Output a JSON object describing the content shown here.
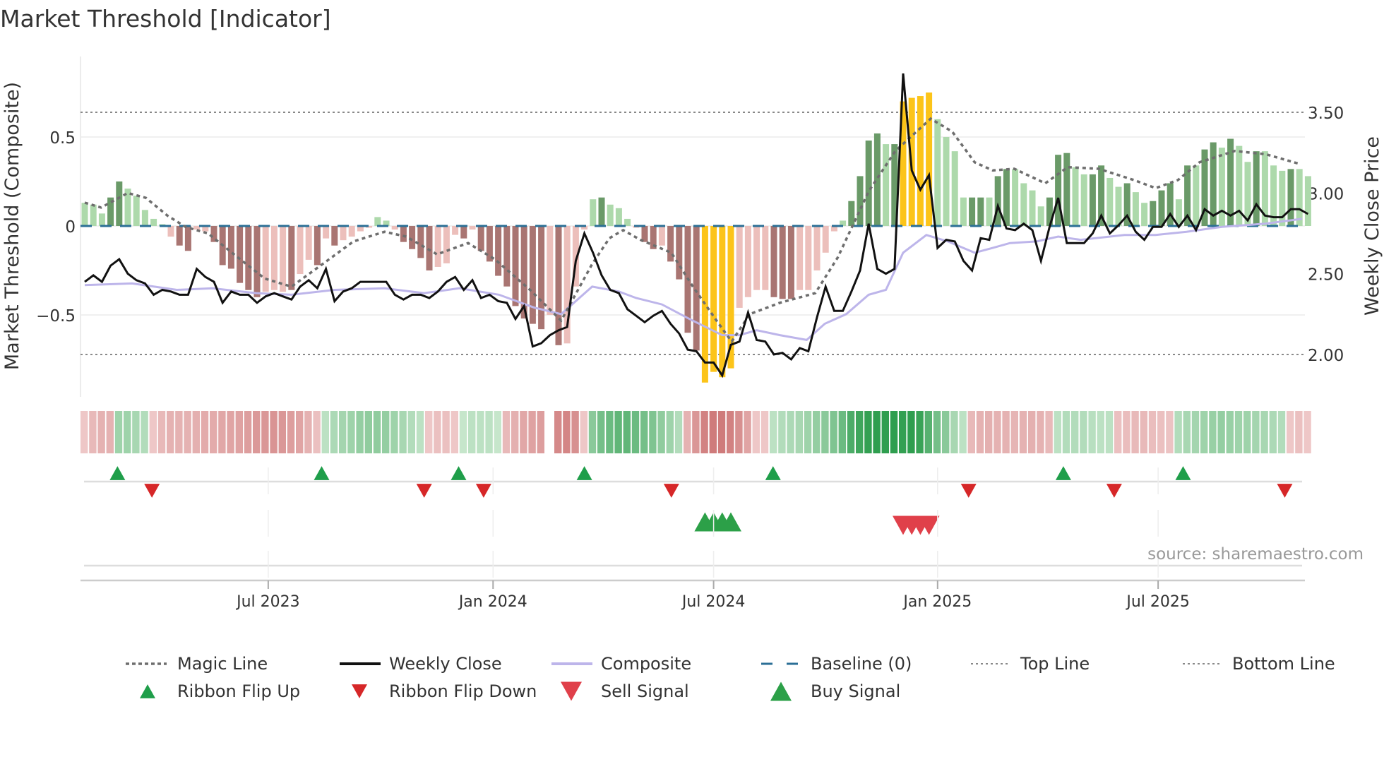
{
  "chart_data": {
    "type": "bar",
    "title": "Market Threshold [Indicator]",
    "ylabel": "Market Threshold (Composite)",
    "ylabel_right": "Weekly Close Price",
    "ylim": [
      -0.88,
      0.86
    ],
    "ylim_right": [
      1.83,
      3.83
    ],
    "yticks": [
      {
        "v": 0.5,
        "label": "0.5"
      },
      {
        "v": 0,
        "label": "0"
      },
      {
        "v": -0.5,
        "label": "−0.5"
      }
    ],
    "yticks_right": [
      {
        "v": 3.5,
        "label": "3.50"
      },
      {
        "v": 3.0,
        "label": "3.00"
      },
      {
        "v": 2.5,
        "label": "2.50"
      },
      {
        "v": 2.0,
        "label": "2.00"
      }
    ],
    "x_unit": "week index",
    "xticks": [
      {
        "x": 21.3,
        "label": "Jul 2023"
      },
      {
        "x": 47.4,
        "label": "Jan 2024"
      },
      {
        "x": 73,
        "label": "Jul 2024"
      },
      {
        "x": 99,
        "label": "Jan 2025"
      },
      {
        "x": 124.6,
        "label": "Jul 2025"
      }
    ],
    "top_line_price": 3.5,
    "bottom_line_price": 2.0,
    "baseline": 0,
    "composite_bars": [
      0.13,
      0.12,
      0.07,
      0.16,
      0.25,
      0.21,
      0.17,
      0.09,
      0.04,
      0.01,
      -0.06,
      -0.11,
      -0.14,
      -0.02,
      -0.03,
      -0.09,
      -0.22,
      -0.24,
      -0.32,
      -0.36,
      -0.4,
      -0.37,
      -0.36,
      -0.37,
      -0.36,
      -0.27,
      -0.19,
      -0.22,
      -0.07,
      -0.11,
      -0.08,
      -0.06,
      -0.03,
      -0.01,
      0.05,
      0.03,
      -0.02,
      -0.09,
      -0.13,
      -0.18,
      -0.25,
      -0.23,
      -0.21,
      -0.05,
      -0.07,
      -0.02,
      -0.14,
      -0.2,
      -0.28,
      -0.34,
      -0.45,
      -0.52,
      -0.55,
      -0.58,
      -0.5,
      -0.67,
      -0.66,
      -0.34,
      -0.02,
      0.15,
      0.16,
      0.12,
      0.1,
      0.04,
      -0.01,
      -0.09,
      -0.13,
      -0.11,
      -0.2,
      -0.3,
      -0.6,
      -0.7,
      -0.88,
      -0.82,
      -0.85,
      -0.8,
      -0.46,
      -0.4,
      -0.36,
      -0.36,
      -0.4,
      -0.41,
      -0.41,
      -0.36,
      -0.36,
      -0.25,
      -0.15,
      -0.03,
      0.03,
      0.14,
      0.28,
      0.48,
      0.52,
      0.46,
      0.46,
      0.7,
      0.72,
      0.73,
      0.75,
      0.6,
      0.5,
      0.42,
      0.16,
      0.16,
      0.16,
      0.16,
      0.28,
      0.32,
      0.32,
      0.24,
      0.2,
      0.11,
      0.16,
      0.4,
      0.41,
      0.33,
      0.29,
      0.29,
      0.34,
      0.27,
      0.22,
      0.24,
      0.19,
      0.13,
      0.14,
      0.2,
      0.24,
      0.15,
      0.34,
      0.34,
      0.43,
      0.47,
      0.44,
      0.49,
      0.45,
      0.36,
      0.42,
      0.42,
      0.34,
      0.31,
      0.32,
      0.32,
      0.28
    ],
    "bar_class": [
      "lg",
      "lg",
      "lg",
      "dg",
      "dg",
      "lg",
      "lg",
      "lg",
      "lg",
      "lg",
      "lr",
      "dr",
      "dr",
      "lr",
      "lr",
      "dr",
      "dr",
      "dr",
      "dr",
      "dr",
      "dr",
      "lr",
      "lr",
      "lr",
      "dr",
      "lr",
      "lr",
      "dr",
      "lr",
      "dr",
      "lr",
      "lr",
      "lr",
      "lr",
      "lg",
      "lg",
      "lr",
      "dr",
      "dr",
      "dr",
      "dr",
      "lr",
      "lr",
      "lr",
      "dr",
      "lr",
      "dr",
      "dr",
      "dr",
      "dr",
      "dr",
      "dr",
      "dr",
      "dr",
      "lr",
      "dr",
      "lr",
      "lr",
      "lr",
      "lg",
      "dg",
      "lg",
      "lg",
      "lg",
      "lr",
      "dr",
      "dr",
      "lr",
      "dr",
      "dr",
      "dr",
      "dr",
      "gold",
      "gold",
      "gold",
      "gold",
      "lr",
      "lr",
      "lr",
      "lr",
      "dr",
      "dr",
      "dr",
      "lr",
      "lr",
      "lr",
      "lr",
      "lr",
      "lg",
      "dg",
      "dg",
      "dg",
      "dg",
      "lg",
      "dg",
      "gold",
      "gold",
      "gold",
      "gold",
      "lg",
      "lg",
      "lg",
      "lg",
      "dg",
      "dg",
      "lg",
      "dg",
      "dg",
      "lg",
      "lg",
      "lg",
      "lg",
      "dg",
      "dg",
      "dg",
      "lg",
      "lg",
      "dg",
      "dg",
      "lg",
      "lg",
      "dg",
      "lg",
      "lg",
      "dg",
      "dg",
      "dg",
      "lg",
      "dg",
      "lg",
      "dg",
      "dg",
      "lg",
      "dg",
      "lg",
      "lg",
      "dg",
      "lg",
      "lg",
      "lg",
      "dg",
      "lg",
      "lg"
    ],
    "weekly_close": [
      2.45,
      2.49,
      2.45,
      2.55,
      2.59,
      2.5,
      2.46,
      2.44,
      2.37,
      2.4,
      2.39,
      2.37,
      2.37,
      2.53,
      2.48,
      2.45,
      2.32,
      2.39,
      2.37,
      2.37,
      2.32,
      2.36,
      2.38,
      2.36,
      2.34,
      2.42,
      2.46,
      2.41,
      2.53,
      2.33,
      2.39,
      2.41,
      2.45,
      2.45,
      2.45,
      2.45,
      2.37,
      2.34,
      2.37,
      2.37,
      2.35,
      2.39,
      2.45,
      2.48,
      2.4,
      2.46,
      2.35,
      2.37,
      2.33,
      2.32,
      2.22,
      2.3,
      2.05,
      2.07,
      2.12,
      2.15,
      2.17,
      2.58,
      2.75,
      2.63,
      2.49,
      2.4,
      2.38,
      2.28,
      2.24,
      2.2,
      2.24,
      2.27,
      2.19,
      2.13,
      2.03,
      2.02,
      1.95,
      1.95,
      1.87,
      2.06,
      2.08,
      2.26,
      2.09,
      2.08,
      2.0,
      2.01,
      1.97,
      2.04,
      2.02,
      2.23,
      2.42,
      2.27,
      2.27,
      2.39,
      2.52,
      2.81,
      2.53,
      2.5,
      2.53,
      3.74,
      3.14,
      3.02,
      3.11,
      2.66,
      2.71,
      2.7,
      2.58,
      2.52,
      2.72,
      2.71,
      2.92,
      2.78,
      2.77,
      2.81,
      2.77,
      2.58,
      2.79,
      2.97,
      2.69,
      2.69,
      2.69,
      2.75,
      2.86,
      2.75,
      2.8,
      2.86,
      2.76,
      2.71,
      2.79,
      2.79,
      2.87,
      2.79,
      2.86,
      2.77,
      2.9,
      2.86,
      2.89,
      2.86,
      2.89,
      2.83,
      2.93,
      2.86,
      2.85,
      2.85,
      2.9,
      2.9,
      2.87
    ],
    "composite_line": [
      [
        0,
        2.43
      ],
      [
        5.5,
        2.44
      ],
      [
        10.7,
        2.4
      ],
      [
        14.8,
        2.41
      ],
      [
        19.9,
        2.38
      ],
      [
        24,
        2.37
      ],
      [
        29,
        2.4
      ],
      [
        34.8,
        2.41
      ],
      [
        39.4,
        2.38
      ],
      [
        43.5,
        2.41
      ],
      [
        48.1,
        2.37
      ],
      [
        52.2,
        2.29
      ],
      [
        55.3,
        2.25
      ],
      [
        58.9,
        2.42
      ],
      [
        62,
        2.39
      ],
      [
        64,
        2.35
      ],
      [
        67,
        2.31
      ],
      [
        70.2,
        2.22
      ],
      [
        74,
        2.12
      ],
      [
        76,
        2.12
      ],
      [
        78,
        2.15
      ],
      [
        80.7,
        2.12
      ],
      [
        83.8,
        2.09
      ],
      [
        85.9,
        2.19
      ],
      [
        88.4,
        2.25
      ],
      [
        91,
        2.37
      ],
      [
        93,
        2.4
      ],
      [
        95,
        2.63
      ],
      [
        97.7,
        2.74
      ],
      [
        100.2,
        2.7
      ],
      [
        103.3,
        2.63
      ],
      [
        105.4,
        2.66
      ],
      [
        107.4,
        2.69
      ],
      [
        110.5,
        2.7
      ],
      [
        113,
        2.73
      ],
      [
        115.6,
        2.71
      ],
      [
        120.7,
        2.74
      ],
      [
        124.3,
        2.74
      ],
      [
        127.9,
        2.76
      ],
      [
        132,
        2.79
      ],
      [
        137,
        2.81
      ],
      [
        141.3,
        2.84
      ]
    ],
    "magic_line": [
      [
        0,
        2.94
      ],
      [
        1.9,
        2.91
      ],
      [
        5,
        3.0
      ],
      [
        7.1,
        2.97
      ],
      [
        9.6,
        2.86
      ],
      [
        11.7,
        2.79
      ],
      [
        14.3,
        2.75
      ],
      [
        17.8,
        2.6
      ],
      [
        20.9,
        2.47
      ],
      [
        24,
        2.42
      ],
      [
        27.1,
        2.54
      ],
      [
        31.2,
        2.7
      ],
      [
        34.8,
        2.76
      ],
      [
        37.3,
        2.73
      ],
      [
        40.9,
        2.62
      ],
      [
        44.5,
        2.69
      ],
      [
        47.6,
        2.59
      ],
      [
        51.7,
        2.4
      ],
      [
        55.3,
        2.21
      ],
      [
        58.9,
        2.56
      ],
      [
        60.9,
        2.72
      ],
      [
        62.5,
        2.77
      ],
      [
        64.5,
        2.71
      ],
      [
        68.1,
        2.63
      ],
      [
        70.6,
        2.42
      ],
      [
        73.6,
        2.19
      ],
      [
        75.1,
        2.08
      ],
      [
        77.2,
        2.25
      ],
      [
        80.7,
        2.32
      ],
      [
        84.8,
        2.38
      ],
      [
        87.4,
        2.6
      ],
      [
        91,
        3.01
      ],
      [
        94.1,
        3.26
      ],
      [
        98.2,
        3.46
      ],
      [
        100.7,
        3.38
      ],
      [
        103.3,
        3.19
      ],
      [
        105.4,
        3.14
      ],
      [
        107.9,
        3.15
      ],
      [
        111.5,
        3.06
      ],
      [
        114.1,
        3.16
      ],
      [
        117.7,
        3.15
      ],
      [
        121.8,
        3.08
      ],
      [
        124.3,
        3.03
      ],
      [
        126.9,
        3.08
      ],
      [
        129.4,
        3.19
      ],
      [
        133.5,
        3.26
      ],
      [
        137.1,
        3.24
      ],
      [
        141,
        3.18
      ]
    ],
    "ribbon": [
      -0.15,
      -0.25,
      -0.3,
      -0.3,
      0.35,
      0.35,
      0.3,
      0.25,
      -0.15,
      -0.25,
      -0.3,
      -0.3,
      -0.3,
      -0.32,
      -0.35,
      -0.35,
      -0.38,
      -0.4,
      -0.42,
      -0.45,
      -0.48,
      -0.5,
      -0.52,
      -0.5,
      -0.45,
      -0.4,
      -0.3,
      -0.2,
      0.2,
      0.28,
      0.32,
      0.35,
      0.4,
      0.42,
      0.42,
      0.4,
      0.35,
      0.3,
      0.25,
      0.2,
      -0.15,
      -0.2,
      -0.2,
      -0.15,
      0.15,
      0.2,
      0.2,
      0.2,
      0.15,
      -0.25,
      -0.32,
      -0.38,
      -0.42,
      -0.45,
      null,
      -0.6,
      -0.62,
      -0.55,
      -0.15,
      0.45,
      0.55,
      0.6,
      0.65,
      0.65,
      0.6,
      0.55,
      0.5,
      0.42,
      0.35,
      0.25,
      -0.3,
      -0.5,
      -0.65,
      -0.7,
      -0.7,
      -0.65,
      -0.55,
      -0.4,
      -0.15,
      -0.15,
      0.2,
      0.25,
      0.28,
      0.3,
      0.35,
      0.4,
      0.45,
      0.5,
      0.6,
      0.75,
      0.82,
      0.88,
      0.9,
      0.9,
      0.9,
      0.88,
      0.9,
      0.85,
      0.7,
      0.55,
      0.45,
      0.3,
      0.2,
      -0.25,
      -0.3,
      -0.32,
      -0.3,
      -0.3,
      -0.28,
      -0.3,
      -0.32,
      -0.3,
      -0.25,
      0.2,
      0.25,
      0.25,
      0.25,
      0.22,
      0.2,
      0.2,
      -0.2,
      -0.22,
      -0.25,
      -0.25,
      -0.22,
      -0.2,
      -0.18,
      0.25,
      0.3,
      0.32,
      0.35,
      0.38,
      0.4,
      0.38,
      0.35,
      0.35,
      0.32,
      0.3,
      0.28,
      0.25,
      -0.15,
      -0.2,
      -0.15
    ],
    "ribbon_flip_up": [
      3.8,
      27.5,
      43.4,
      58,
      79.9,
      113.6,
      127.5
    ],
    "ribbon_flip_down": [
      7.8,
      39.4,
      46.3,
      68.1,
      102.6,
      119.5,
      139.3
    ],
    "buy_signals": [
      72,
      73,
      74,
      75
    ],
    "sell_signals": [
      95,
      96,
      97,
      98
    ],
    "legend": {
      "placement": "bottom",
      "items": [
        {
          "key": "magic",
          "label": "Magic Line"
        },
        {
          "key": "close",
          "label": "Weekly Close"
        },
        {
          "key": "composite",
          "label": "Composite"
        },
        {
          "key": "baseline",
          "label": "Baseline (0)"
        },
        {
          "key": "top",
          "label": "Top Line"
        },
        {
          "key": "bottom",
          "label": "Bottom Line"
        },
        {
          "key": "flipup",
          "label": "Ribbon Flip Up"
        },
        {
          "key": "flipdown",
          "label": "Ribbon Flip Down"
        },
        {
          "key": "sell",
          "label": "Sell Signal"
        },
        {
          "key": "buy",
          "label": "Buy Signal"
        }
      ]
    },
    "source": "source: sharemaestro.com"
  },
  "colors": {
    "dg": "#6a9a68",
    "lg": "#add9ab",
    "dr": "#a97572",
    "lr": "#ecbfbb",
    "gold": "#fcc419",
    "close": "#111111",
    "composite": "#bdb5ea",
    "magic": "#6e6e6e",
    "baseline": "#2b6f96",
    "flipup": "#1f9e4a",
    "flipdown": "#d62728",
    "sell": "#e0404a",
    "buy": "#2ca048"
  }
}
